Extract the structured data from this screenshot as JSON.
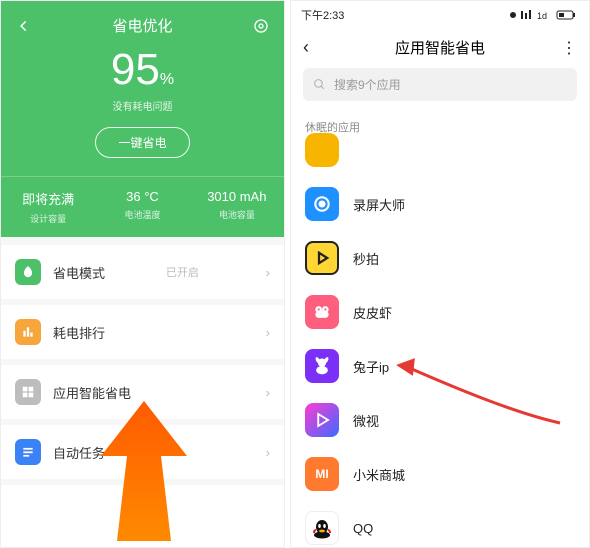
{
  "left": {
    "header": {
      "title": "省电优化",
      "percent": "95",
      "percent_unit": "%",
      "subtitle": "没有耗电问题",
      "action": "一键省电"
    },
    "stats": [
      {
        "value": "即将充满",
        "label": "设计容量"
      },
      {
        "value": "36 °C",
        "label": "电池温度"
      },
      {
        "value": "3010 mAh",
        "label": "电池容量"
      }
    ],
    "menu": [
      {
        "label": "省电模式",
        "hint": "已开启"
      },
      {
        "label": "耗电排行",
        "hint": ""
      },
      {
        "label": "应用智能省电",
        "hint": ""
      },
      {
        "label": "自动任务",
        "hint": ""
      }
    ]
  },
  "right": {
    "status": {
      "time": "下午2:33"
    },
    "header": {
      "title": "应用智能省电"
    },
    "search": {
      "placeholder": "搜索9个应用"
    },
    "section": "休眠的应用",
    "apps": [
      {
        "label": ""
      },
      {
        "label": "录屏大师"
      },
      {
        "label": "秒拍"
      },
      {
        "label": "皮皮虾"
      },
      {
        "label": "兔子ip"
      },
      {
        "label": "微视"
      },
      {
        "label": "小米商城"
      },
      {
        "label": "QQ"
      }
    ]
  }
}
